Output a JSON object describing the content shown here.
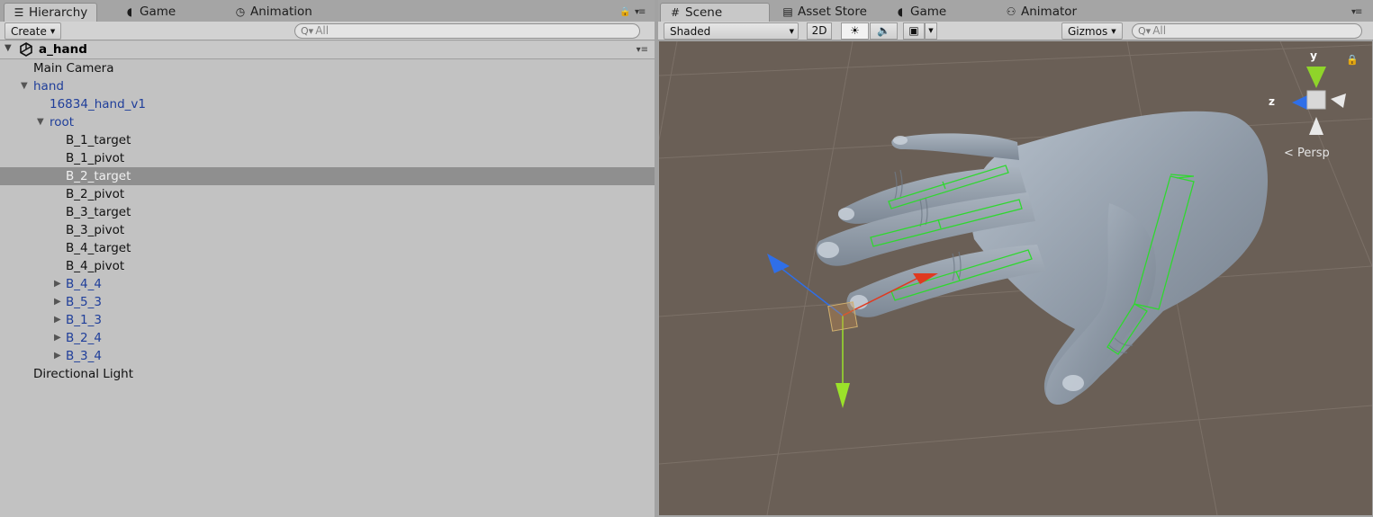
{
  "hierarchy": {
    "tabs": [
      {
        "label": "Hierarchy",
        "icon": "list-icon"
      },
      {
        "label": "Game",
        "icon": "pacman-icon"
      },
      {
        "label": "Animation",
        "icon": "clock-icon"
      }
    ],
    "create_label": "Create",
    "search_placeholder": "All",
    "scene_name": "a_hand",
    "items": [
      {
        "label": "Main Camera"
      },
      {
        "label": "hand"
      },
      {
        "label": "16834_hand_v1"
      },
      {
        "label": "root"
      },
      {
        "label": "B_1_target"
      },
      {
        "label": "B_1_pivot"
      },
      {
        "label": "B_2_target"
      },
      {
        "label": "B_2_pivot"
      },
      {
        "label": "B_3_target"
      },
      {
        "label": "B_3_pivot"
      },
      {
        "label": "B_4_target"
      },
      {
        "label": "B_4_pivot"
      },
      {
        "label": "B_4_4"
      },
      {
        "label": "B_5_3"
      },
      {
        "label": "B_1_3"
      },
      {
        "label": "B_2_4"
      },
      {
        "label": "B_3_4"
      },
      {
        "label": "Directional Light"
      }
    ],
    "selected_item": "B_2_target"
  },
  "scene": {
    "tabs": [
      {
        "label": "Scene",
        "icon": "grid-icon"
      },
      {
        "label": "Asset Store",
        "icon": "store-icon"
      },
      {
        "label": "Game",
        "icon": "pacman-icon"
      },
      {
        "label": "Animator",
        "icon": "animator-icon"
      }
    ],
    "shading_mode": "Shaded",
    "mode_2d_label": "2D",
    "gizmos_label": "Gizmos",
    "search_placeholder": "All",
    "projection_label": "Persp",
    "axis_labels": {
      "y": "y",
      "z": "z"
    }
  },
  "colors": {
    "viewport_bg": "#6a5f56",
    "bone_outline": "#2fd82f",
    "axis_x": "#e0391f",
    "axis_y": "#9be22a",
    "axis_z": "#2f6fe8",
    "selection_bg": "#8f8f8f",
    "prefab_blue": "#1f3e9a"
  }
}
